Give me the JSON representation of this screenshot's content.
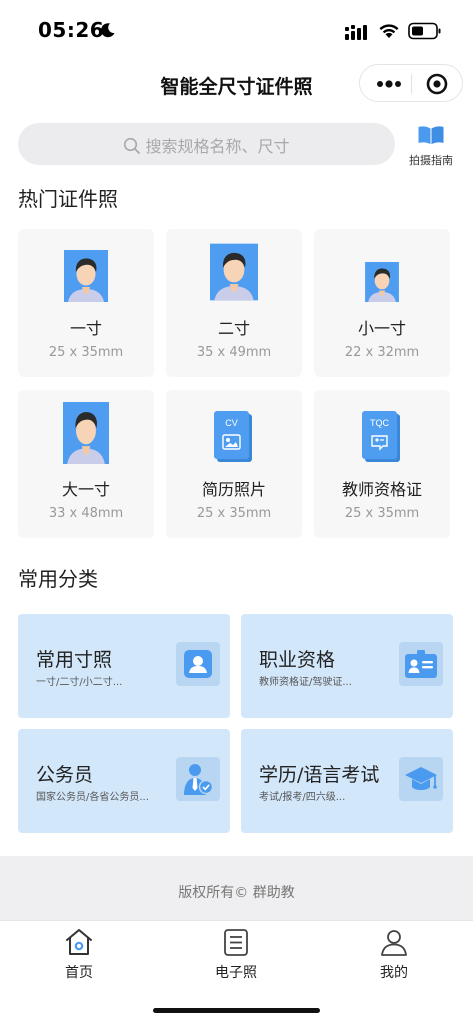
{
  "status_bar": {
    "time": "05:26"
  },
  "nav": {
    "title": "智能全尺寸证件照"
  },
  "search": {
    "placeholder": "搜索规格名称、尺寸",
    "guide_label": "拍摄指南"
  },
  "hot": {
    "title": "热门证件照",
    "items": [
      {
        "name": "一寸",
        "size": "25 x 35mm",
        "icon": "portrait-photo"
      },
      {
        "name": "二寸",
        "size": "35 x 49mm",
        "icon": "portrait-photo"
      },
      {
        "name": "小一寸",
        "size": "22 x 32mm",
        "icon": "portrait-photo"
      },
      {
        "name": "大一寸",
        "size": "33 x 48mm",
        "icon": "portrait-photo"
      },
      {
        "name": "简历照片",
        "size": "25 x 35mm",
        "icon": "cv-document",
        "badge": "CV"
      },
      {
        "name": "教师资格证",
        "size": "25 x 35mm",
        "icon": "tqc-document",
        "badge": "TQC"
      }
    ]
  },
  "categories": {
    "title": "常用分类",
    "items": [
      {
        "title": "常用寸照",
        "sub": "一寸/二寸/小二寸...",
        "icon": "user-photo-icon"
      },
      {
        "title": "职业资格",
        "sub": "教师资格证/驾驶证...",
        "icon": "id-card-icon"
      },
      {
        "title": "公务员",
        "sub": "国家公务员/各省公务员...",
        "icon": "civil-servant-icon"
      },
      {
        "title": "学历/语言考试",
        "sub": "考试/报考/四六级...",
        "icon": "graduation-cap-icon"
      }
    ]
  },
  "footer": {
    "copyright": "版权所有© 群助教"
  },
  "tabbar": {
    "items": [
      {
        "label": "首页",
        "active": true
      },
      {
        "label": "电子照",
        "active": false
      },
      {
        "label": "我的",
        "active": false
      }
    ]
  },
  "colors": {
    "accent": "#4a9bef",
    "card_bg": "#d3e7fa",
    "photo_bg": "#4f9df0"
  }
}
